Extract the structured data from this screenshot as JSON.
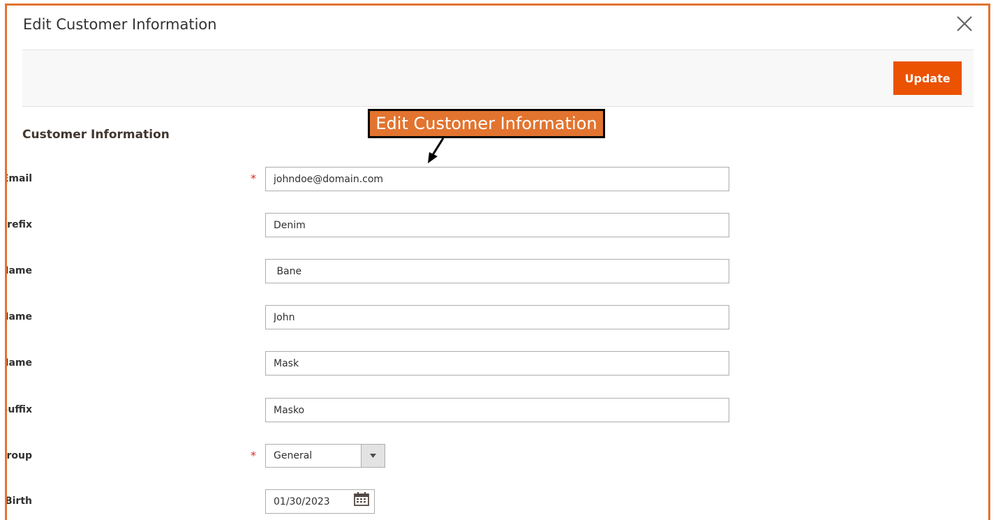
{
  "modal": {
    "title": "Edit Customer Information",
    "update_label": "Update"
  },
  "callout": {
    "text": "Edit Customer Information"
  },
  "section": {
    "title": "Customer Information"
  },
  "fields": {
    "email": {
      "label": "Customer Email",
      "value": "johndoe@domain.com",
      "required": "*"
    },
    "prefix": {
      "label": "Name Prefix",
      "value": "Denim"
    },
    "first_name": {
      "label": "First Name",
      "value": " Bane"
    },
    "middle_name": {
      "label": "Middle Name",
      "value": "John"
    },
    "last_name": {
      "label": "Last Name",
      "value": "Mask"
    },
    "suffix": {
      "label": "Name Suffix",
      "value": "Masko"
    },
    "group": {
      "label": "Customer Group",
      "value": "General",
      "required": "*"
    },
    "dob": {
      "label": "Date of Birth",
      "value": "01/30/2023"
    }
  },
  "colors": {
    "accent": "#e2742f",
    "button": "#eb5202",
    "required": "#e22626"
  },
  "icons": {
    "close": "close-icon",
    "dropdown": "chevron-down-icon",
    "calendar": "calendar-icon",
    "arrow": "arrow-icon"
  }
}
